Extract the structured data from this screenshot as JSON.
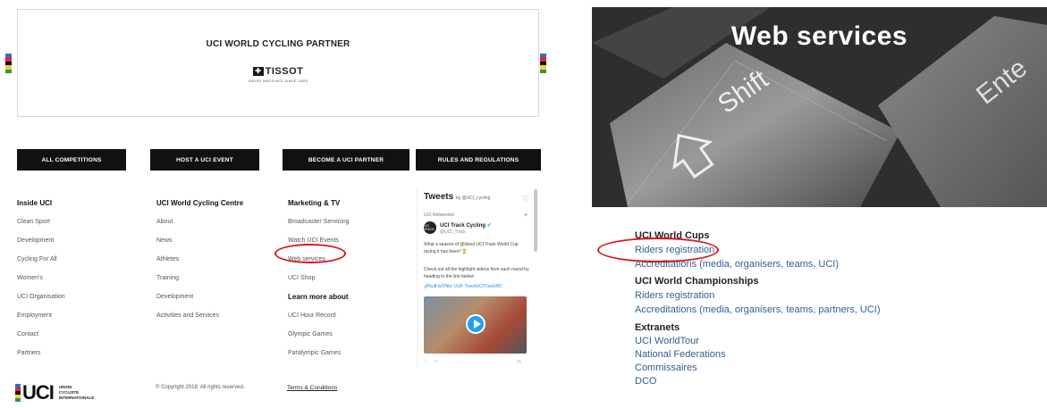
{
  "left": {
    "partner_title": "UCI WORLD CYCLING PARTNER",
    "partner_brand": "TISSOT",
    "partner_tagline": "SWISS WATCHES SINCE 1853",
    "nav_buttons": [
      "ALL COMPETITIONS",
      "HOST A UCI EVENT",
      "BECOME A UCI PARTNER",
      "RULES AND REGULATIONS"
    ],
    "col1": {
      "heading": "Inside UCI",
      "items": [
        "Clean Sport",
        "Development",
        "Cycling For All",
        "Women's",
        "UCI Organisation",
        "Employment",
        "Contact",
        "Partners"
      ]
    },
    "col2": {
      "heading": "UCI World Cycling Centre",
      "items": [
        "About",
        "News",
        "Athletes",
        "Training",
        "Development",
        "Activities and Services"
      ]
    },
    "col3": {
      "heading": "Marketing & TV",
      "items": [
        "Broadcaster Servicing",
        "Watch UCI Events",
        "Web services",
        "UCI Shop"
      ],
      "subheading": "Learn more about",
      "sub_items": [
        "UCI Hour Record",
        "Olympic Games",
        "Paralympic Games"
      ]
    },
    "tweets": {
      "title": "Tweets",
      "by": "by @UCI_cycling",
      "retweeted": "UCI Retweeted",
      "account_name": "UCI Track Cycling",
      "account_handle": "@UCI_Track",
      "avatar_text": "UCI TRACK",
      "text1": "What a season of @tissot UCI Track World Cup racing it has been! 🏆",
      "text2": "Check out all the highlight videos from each round by heading to the link below!",
      "link": "🔗buff.ly/2Nbc UUF TissotUCITrackWC",
      "time": "7h"
    },
    "footer": {
      "logo_letters": "UCI",
      "logo_sub": [
        "UNION",
        "CYCLISTE",
        "INTERNATIONALE"
      ],
      "copyright": "© Copyright 2018. All rights reserved.",
      "terms": "Terms & Conditions"
    }
  },
  "right": {
    "hero_title": "Web services",
    "key_shift": "Shift",
    "key_enter": "Ente",
    "sections": [
      {
        "heading": "UCI World Cups",
        "links": [
          "Riders registration",
          "Accreditations (media, organisers, teams, UCI)"
        ]
      },
      {
        "heading": "UCI World Championships",
        "links": [
          "Riders registration",
          "Accreditations (media, organisers, teams, partners, UCI)"
        ]
      },
      {
        "heading": "Extranets",
        "links": [
          "UCI WorldTour",
          "National Federations",
          "Commissaires",
          "DCO"
        ]
      }
    ]
  },
  "colors": {
    "uci_stripes": [
      "#2b6fd6",
      "#e3262a",
      "#111111",
      "#f2d02b",
      "#2a9a47"
    ],
    "highlight": "#d9141e",
    "link": "#2f5f92"
  }
}
